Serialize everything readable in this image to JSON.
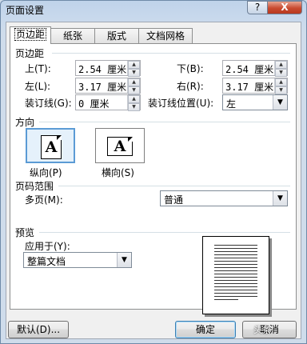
{
  "window": {
    "title": "页面设置",
    "help_label": "?",
    "close_label": "X"
  },
  "tabs": [
    {
      "label": "页边距",
      "selected": true
    },
    {
      "label": "纸张",
      "selected": false
    },
    {
      "label": "版式",
      "selected": false
    },
    {
      "label": "文档网格",
      "selected": false
    }
  ],
  "margins": {
    "section": "页边距",
    "top": {
      "label": "上(T):",
      "value": "2.54 厘米"
    },
    "bottom": {
      "label": "下(B):",
      "value": "2.54 厘米"
    },
    "left": {
      "label": "左(L):",
      "value": "3.17 厘米"
    },
    "right": {
      "label": "右(R):",
      "value": "3.17 厘米"
    },
    "gutter": {
      "label": "装订线(G):",
      "value": "0 厘米"
    },
    "gutter_pos": {
      "label": "装订线位置(U):",
      "value": "左"
    }
  },
  "orientation": {
    "section": "方向",
    "portrait": "纵向(P)",
    "landscape": "横向(S)",
    "glyph": "A"
  },
  "pages": {
    "section": "页码范围",
    "multi_label": "多页(M):",
    "multi_value": "普通"
  },
  "preview": {
    "section": "预览",
    "apply_label": "应用于(Y):",
    "apply_value": "整篇文档"
  },
  "buttons": {
    "default": "默认(D)...",
    "ok": "确定",
    "cancel": "取消"
  },
  "watermark": "头条"
}
